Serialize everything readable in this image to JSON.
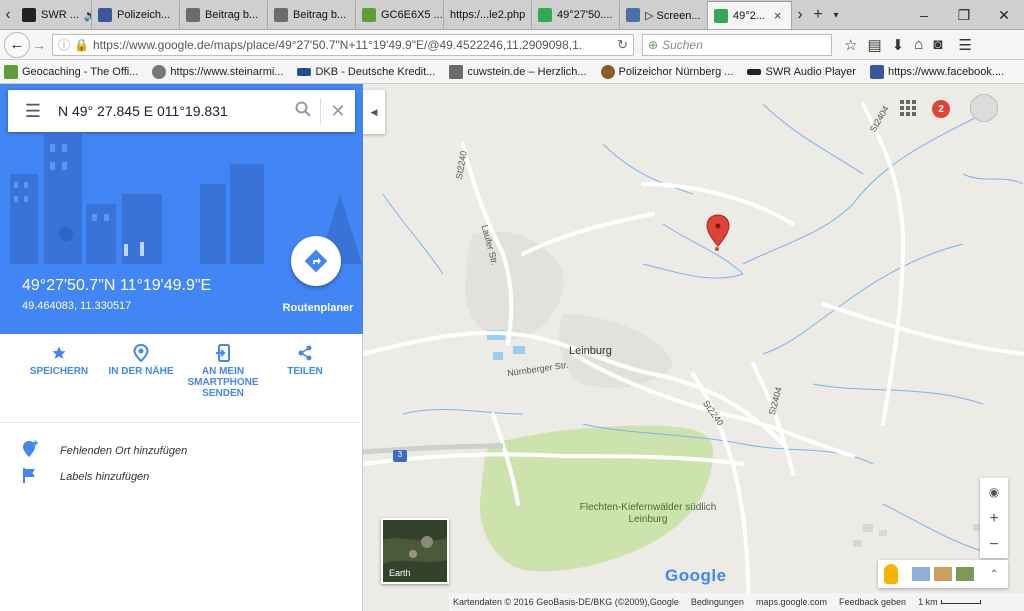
{
  "browser": {
    "tabs": [
      {
        "label": "SWR ...",
        "icon": "swr-icon",
        "color": "#222222",
        "active": false
      },
      {
        "label": "Polizeich...",
        "icon": "facebook-icon",
        "color": "#3b5998",
        "active": false
      },
      {
        "label": "Beitrag b...",
        "icon": "forum-icon",
        "color": "#6b6b6b",
        "active": false
      },
      {
        "label": "Beitrag b...",
        "icon": "forum-icon",
        "color": "#6b6b6b",
        "active": false
      },
      {
        "label": "GC6E6X5 ...",
        "icon": "geocaching-icon",
        "color": "#5f9e35",
        "active": false
      },
      {
        "label": "https:/...le2.php",
        "icon": "blank-page-icon",
        "color": "#dddddd",
        "active": false
      },
      {
        "label": "49°27'50....",
        "icon": "maps-icon",
        "color": "#34a853",
        "active": false
      },
      {
        "label": "▷ Screen...",
        "icon": "screen-icon",
        "color": "#4a6fa5",
        "active": false
      },
      {
        "label": "49°2...",
        "icon": "maps-icon",
        "color": "#34a853",
        "active": true
      }
    ],
    "url": "https://www.google.de/maps/place/49°27'50.7\"N+11°19'49.9\"E/@49.4522246,11.2909098,1.",
    "search_placeholder": "Suchen",
    "bookmarks": [
      {
        "label": "Geocaching - The Offi...",
        "icon": "geocaching-icon",
        "color": "#5f9e35"
      },
      {
        "label": "https://www.steinarmi...",
        "icon": "globe-icon",
        "color": "#777777"
      },
      {
        "label": "DKB - Deutsche Kredit...",
        "icon": "dkb-icon",
        "color": "#1d4f91"
      },
      {
        "label": "cuwstein.de – Herzlich...",
        "icon": "forum-icon",
        "color": "#6b6b6b"
      },
      {
        "label": "Polizeichor Nürnberg ...",
        "icon": "police-icon",
        "color": "#8b5a2b"
      },
      {
        "label": "SWR Audio Player",
        "icon": "swr-icon",
        "color": "#222222"
      },
      {
        "label": "https://www.facebook....",
        "icon": "facebook-icon",
        "color": "#3b5998"
      }
    ]
  },
  "maps": {
    "search_query": "N 49° 27.845 E 011°19.831",
    "place_title": "49°27'50.7\"N 11°19'49.9\"E",
    "place_coords": "49.464083, 11.330517",
    "route_label": "Routenplaner",
    "actions": [
      {
        "label": "SPEICHERN",
        "icon": "star-icon"
      },
      {
        "label": "IN DER NÄHE",
        "icon": "nearby-icon"
      },
      {
        "label": "AN MEIN SMARTPHONE SENDEN",
        "icon": "send-to-phone-icon"
      },
      {
        "label": "TEILEN",
        "icon": "share-icon"
      }
    ],
    "extra_items": [
      {
        "label": "Fehlenden Ort hinzufügen",
        "icon": "add-place-icon"
      },
      {
        "label": "Labels hinzufügen",
        "icon": "flag-icon"
      }
    ],
    "notification_count": "2",
    "earth_label": "Earth",
    "map_labels": {
      "town": "Leinburg",
      "forest": "Flechten-Kiefernwälder südlich Leinburg",
      "road_nurnberger": "Nürnberger Str.",
      "road_laufer": "Laufer Str.",
      "road_st2240_a": "St2240",
      "road_st2240_b": "St2240",
      "road_st2404_a": "St2404",
      "road_st2404_b": "St2404",
      "highway": "3"
    },
    "google_logo": "Google",
    "footer": {
      "attribution": "Kartendaten © 2016 GeoBasis-DE/BKG (©2009),Google",
      "terms": "Bedingungen",
      "site": "maps.google.com",
      "feedback": "Feedback geben",
      "scale": "1 km"
    },
    "colors": {
      "accent": "#4285f4",
      "pin": "#db4437",
      "forest": "#cde3ad",
      "water": "#5aa0e6"
    }
  }
}
